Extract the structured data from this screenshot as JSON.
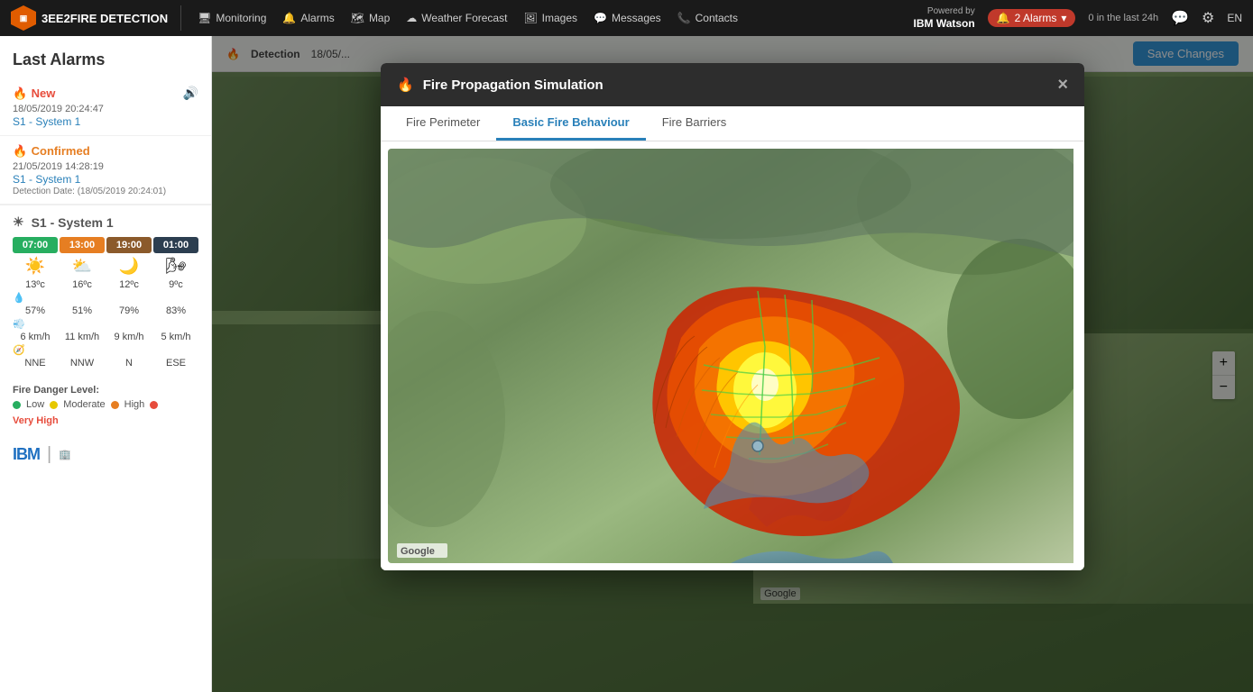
{
  "app": {
    "name": "3EE2FIRE DETECTION"
  },
  "topnav": {
    "items": [
      {
        "label": "Monitoring",
        "icon": "monitor"
      },
      {
        "label": "Alarms",
        "icon": "alarm"
      },
      {
        "label": "Map",
        "icon": "map"
      },
      {
        "label": "Weather Forecast",
        "icon": "cloud"
      },
      {
        "label": "Images",
        "icon": "image"
      },
      {
        "label": "Messages",
        "icon": "message"
      },
      {
        "label": "Contacts",
        "icon": "contact"
      }
    ],
    "powered_by": "Powered by",
    "powered_by_name": "IBM Watson",
    "alarms_label": "2 Alarms",
    "alarms_count_small": "0 in the last 24h",
    "lang": "EN"
  },
  "sidebar": {
    "title": "Last Alarms",
    "alarms": [
      {
        "status": "New",
        "status_type": "new",
        "date": "18/05/2019 20:24:47",
        "system": "S1 - System 1",
        "detection": ""
      },
      {
        "status": "Confirmed",
        "status_type": "confirmed",
        "date": "21/05/2019 14:28:19",
        "system": "S1 - System 1",
        "detection": "Detection Date: (18/05/2019 20:24:01)"
      }
    ],
    "weather_system": "S1 - System 1",
    "weather_times": [
      "07:00",
      "13:00",
      "19:00",
      "01:00"
    ],
    "weather_temps": [
      "13ºc",
      "16ºc",
      "12ºc",
      "9ºc"
    ],
    "weather_humidity": [
      "57%",
      "51%",
      "79%",
      "83%"
    ],
    "weather_wind_speed": [
      "6 km/h",
      "11 km/h",
      "9 km/h",
      "5 km/h"
    ],
    "weather_wind_dir": [
      "NNE",
      "NNW",
      "N",
      "ESE"
    ],
    "fire_danger_label": "Fire Danger Level:",
    "fire_danger_items": [
      {
        "label": "Low",
        "color_class": "dot-green"
      },
      {
        "label": "Moderate",
        "color_class": "dot-yellow"
      },
      {
        "label": "High",
        "color_class": "dot-orange"
      },
      {
        "label": "Very High",
        "color_class": "dot-red"
      }
    ]
  },
  "detection_bar": {
    "label": "Detection",
    "date": "18/05/..."
  },
  "save_button": "Save Changes",
  "modal": {
    "title": "Fire Propagation Simulation",
    "tabs": [
      {
        "label": "Fire Perimeter",
        "active": false
      },
      {
        "label": "Basic Fire Behaviour",
        "active": true
      },
      {
        "label": "Fire Barriers",
        "active": false
      }
    ],
    "close_label": "×"
  },
  "fire_map": {
    "google_label": "Google"
  }
}
